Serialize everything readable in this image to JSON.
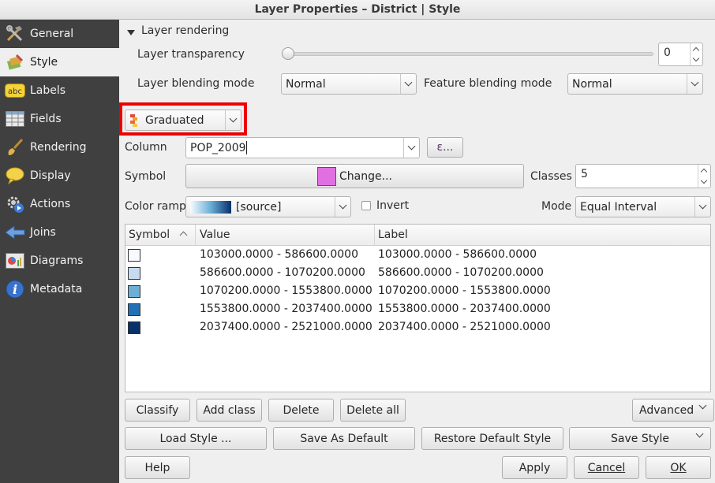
{
  "window": {
    "title": "Layer Properties – District | Style"
  },
  "sidebar": {
    "items": [
      {
        "label": "General",
        "icon": "hammer-wrench-icon",
        "active": false
      },
      {
        "label": "Style",
        "icon": "paint-style-icon",
        "active": true
      },
      {
        "label": "Labels",
        "icon": "abc-label-icon",
        "active": false
      },
      {
        "label": "Fields",
        "icon": "table-fields-icon",
        "active": false
      },
      {
        "label": "Rendering",
        "icon": "brush-icon",
        "active": false
      },
      {
        "label": "Display",
        "icon": "speech-bubble-icon",
        "active": false
      },
      {
        "label": "Actions",
        "icon": "gear-play-icon",
        "active": false
      },
      {
        "label": "Joins",
        "icon": "join-arrow-icon",
        "active": false
      },
      {
        "label": "Diagrams",
        "icon": "diagram-icon",
        "active": false
      },
      {
        "label": "Metadata",
        "icon": "info-icon",
        "active": false
      }
    ]
  },
  "rendering": {
    "section_label": "Layer rendering",
    "transparency_label": "Layer transparency",
    "transparency_value": "0",
    "transparency_fraction": 0,
    "blending_label": "Layer blending mode",
    "blending_value": "Normal",
    "feature_blending_label": "Feature blending mode",
    "feature_blending_value": "Normal"
  },
  "renderer": {
    "type": "Graduated"
  },
  "form": {
    "column_label": "Column",
    "column_value": "POP_2009",
    "expression_button": "ε...",
    "symbol_label": "Symbol",
    "symbol_button": "Change...",
    "symbol_color": "#e070e0",
    "classes_label": "Classes",
    "classes_value": "5",
    "ramp_label": "Color ramp",
    "ramp_value": "[source]",
    "invert_label": "Invert",
    "invert_checked": false,
    "mode_label": "Mode",
    "mode_value": "Equal Interval"
  },
  "table": {
    "headers": {
      "symbol": "Symbol",
      "value": "Value",
      "label": "Label"
    },
    "rows": [
      {
        "color": "#f7fbff",
        "value": "103000.0000 - 586600.0000",
        "label": "103000.0000 - 586600.0000"
      },
      {
        "color": "#c6dbef",
        "value": "586600.0000 - 1070200.0000",
        "label": "586600.0000 - 1070200.0000"
      },
      {
        "color": "#6baed6",
        "value": "1070200.0000 - 1553800.0000",
        "label": "1070200.0000 - 1553800.0000"
      },
      {
        "color": "#2171b5",
        "value": "1553800.0000 - 2037400.0000",
        "label": "1553800.0000 - 2037400.0000"
      },
      {
        "color": "#08306b",
        "value": "2037400.0000 - 2521000.0000",
        "label": "2037400.0000 - 2521000.0000"
      }
    ]
  },
  "actions": {
    "classify": "Classify",
    "add_class": "Add class",
    "delete": "Delete",
    "delete_all": "Delete all",
    "advanced": "Advanced"
  },
  "style_buttons": {
    "load_style": "Load Style ...",
    "save_default": "Save As Default",
    "restore_default": "Restore Default Style",
    "save_style": "Save Style"
  },
  "dialog": {
    "help": "Help",
    "apply": "Apply",
    "cancel": "Cancel",
    "ok": "OK"
  }
}
